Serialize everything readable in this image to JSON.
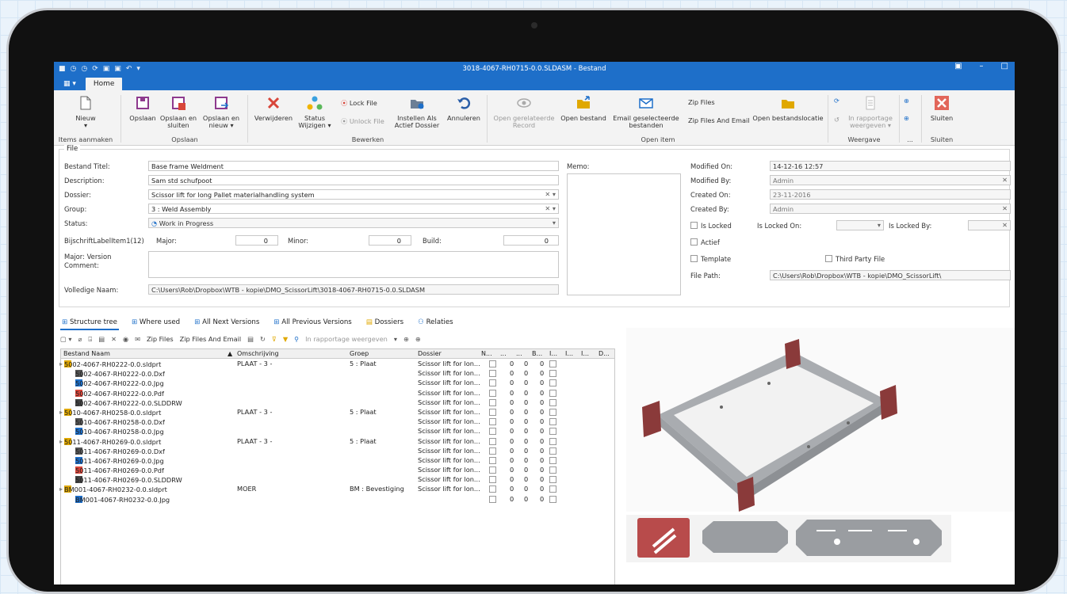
{
  "window": {
    "title": "3018-4067-RH0715-0.0.SLDASM - Bestand",
    "file_button": "▦ ▾",
    "home_tab": "Home"
  },
  "ribbon": {
    "groups": {
      "items_aanmaken": "Items aanmaken",
      "opslaan": "Opslaan",
      "bewerken": "Bewerken",
      "open_item": "Open item",
      "weergave": "Weergave",
      "dots": "...",
      "sluiten": "Sluiten"
    },
    "buttons": {
      "nieuw": "Nieuw",
      "opslaan": "Opslaan",
      "opslaan_en_sluiten": "Opslaan en sluiten",
      "opslaan_en_nieuw": "Opslaan en nieuw",
      "verwijderen": "Verwijderen",
      "status_wijzigen": "Status Wijzigen",
      "lock_file": "Lock File",
      "unlock_file": "Unlock File",
      "instellen_als_actief_dossier": "Instellen Als Actief Dossier",
      "annuleren": "Annuleren",
      "open_gerelateerde_record": "Open gerelateerde Record",
      "open_bestand": "Open bestand",
      "email_geselecteerde_bestanden": "Email geselecteerde bestanden",
      "zip_files": "Zip Files",
      "zip_files_and_email": "Zip Files And Email",
      "open_bestandslocatie": "Open bestandslocatie",
      "in_rapportage_weergeven": "In rapportage weergeven",
      "sluiten": "Sluiten"
    }
  },
  "file_panel": {
    "legend": "File",
    "labels": {
      "bestand_titel": "Bestand Titel:",
      "description": "Description:",
      "dossier": "Dossier:",
      "group": "Group:",
      "status": "Status:",
      "bijschrift": "BijschriftLabelItem1(12)",
      "major": "Major:",
      "minor": "Minor:",
      "build": "Build:",
      "major_version_comment": "Major: Version Comment:",
      "volledige_naam": "Volledige Naam:",
      "memo": "Memo:",
      "modified_on": "Modified On:",
      "modified_by": "Modified By:",
      "created_on": "Created On:",
      "created_by": "Created By:",
      "is_locked": "Is Locked",
      "is_locked_on": "Is Locked On:",
      "is_locked_by": "Is Locked By:",
      "actief": "Actief",
      "template": "Template",
      "third_party_file": "Third Party File",
      "file_path": "File Path:"
    },
    "values": {
      "bestand_titel": "Base frame Weldment",
      "description": "Sam std schufpoot",
      "dossier": "Scissor lift for long Pallet materialhandling system",
      "group": "3 : Weld Assembly",
      "status": "Work in Progress",
      "major": "0",
      "minor": "0",
      "build": "0",
      "volledige_naam": "C:\\Users\\Rob\\Dropbox\\WTB - kopie\\DMO_ScissorLift\\3018-4067-RH0715-0.0.SLDASM",
      "modified_on": "14-12-16 12:57",
      "modified_by": "Admin",
      "created_on": "23-11-2016",
      "created_by": "Admin",
      "file_path": "C:\\Users\\Rob\\Dropbox\\WTB - kopie\\DMO_ScissorLift\\"
    }
  },
  "bottom_tabs": [
    "Structure tree",
    "Where used",
    "All Next Versions",
    "All Previous Versions",
    "Dossiers",
    "Relaties"
  ],
  "tree_toolbar": {
    "zip_files": "Zip Files",
    "zip_files_and_email": "Zip Files And Email",
    "in_rapportage": "In rapportage weergeven"
  },
  "grid": {
    "columns": [
      "Bestand Naam",
      "Omschrijving",
      "Groep",
      "Dossier",
      "N...",
      "...",
      "...",
      "B...",
      "I...",
      "I...",
      "I...",
      "D..."
    ],
    "rows": [
      {
        "name": "5002-4067-RH0222-0.0.sldprt",
        "desc": "PLAAT - 3 -",
        "group": "5 : Plaat",
        "dossier": "Scissor lift for lon...",
        "indent": 0,
        "icon": "part"
      },
      {
        "name": "5002-4067-RH0222-0.0.Dxf",
        "desc": "",
        "group": "",
        "dossier": "Scissor lift for lon...",
        "indent": 1,
        "icon": "dxf"
      },
      {
        "name": "5002-4067-RH0222-0.0.Jpg",
        "desc": "",
        "group": "",
        "dossier": "Scissor lift for lon...",
        "indent": 1,
        "icon": "jpg"
      },
      {
        "name": "5002-4067-RH0222-0.0.Pdf",
        "desc": "",
        "group": "",
        "dossier": "Scissor lift for lon...",
        "indent": 1,
        "icon": "pdf"
      },
      {
        "name": "5002-4067-RH0222-0.0.SLDDRW",
        "desc": "",
        "group": "",
        "dossier": "Scissor lift for lon...",
        "indent": 1,
        "icon": "drw"
      },
      {
        "name": "5010-4067-RH0258-0.0.sldprt",
        "desc": "PLAAT - 3 -",
        "group": "5 : Plaat",
        "dossier": "Scissor lift for lon...",
        "indent": 0,
        "icon": "part"
      },
      {
        "name": "5010-4067-RH0258-0.0.Dxf",
        "desc": "",
        "group": "",
        "dossier": "Scissor lift for lon...",
        "indent": 1,
        "icon": "dxf"
      },
      {
        "name": "5010-4067-RH0258-0.0.Jpg",
        "desc": "",
        "group": "",
        "dossier": "Scissor lift for lon...",
        "indent": 1,
        "icon": "jpg"
      },
      {
        "name": "5011-4067-RH0269-0.0.sldprt",
        "desc": "PLAAT - 3 -",
        "group": "5 : Plaat",
        "dossier": "Scissor lift for lon...",
        "indent": 0,
        "icon": "part"
      },
      {
        "name": "5011-4067-RH0269-0.0.Dxf",
        "desc": "",
        "group": "",
        "dossier": "Scissor lift for lon...",
        "indent": 1,
        "icon": "dxf"
      },
      {
        "name": "5011-4067-RH0269-0.0.Jpg",
        "desc": "",
        "group": "",
        "dossier": "Scissor lift for lon...",
        "indent": 1,
        "icon": "jpg"
      },
      {
        "name": "5011-4067-RH0269-0.0.Pdf",
        "desc": "",
        "group": "",
        "dossier": "Scissor lift for lon...",
        "indent": 1,
        "icon": "pdf"
      },
      {
        "name": "5011-4067-RH0269-0.0.SLDDRW",
        "desc": "",
        "group": "",
        "dossier": "Scissor lift for lon...",
        "indent": 1,
        "icon": "drw"
      },
      {
        "name": "BM001-4067-RH0232-0.0.sldprt",
        "desc": "MOER",
        "group": "BM : Bevestiging",
        "dossier": "Scissor lift for lon...",
        "indent": 0,
        "icon": "part"
      },
      {
        "name": "BM001-4067-RH0232-0.0.Jpg",
        "desc": "",
        "group": "",
        "dossier": "",
        "indent": 1,
        "icon": "jpg"
      }
    ],
    "zero": "0"
  },
  "colors": {
    "accent": "#1e6fc9",
    "red_icon": "#d8463a",
    "part_icon": "#e0a800"
  }
}
